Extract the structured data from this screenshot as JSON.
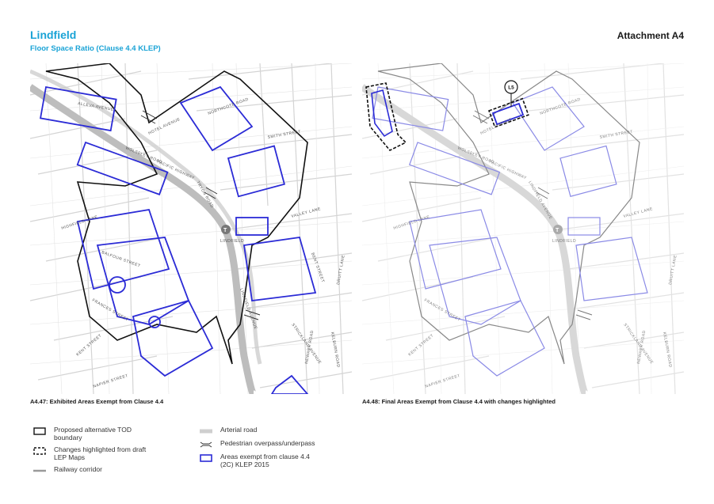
{
  "header": {
    "title": "Lindfield",
    "subtitle": "Floor Space Ratio (Clause 4.4 KLEP)",
    "attachment": "Attachment A4"
  },
  "maps": {
    "left": {
      "caption": "A4.47: Exhibited Areas Exempt from Clause 4.4",
      "streets": [
        "NORTHCOTE ROAD",
        "SMITH STREET",
        "VALLEY LANE",
        "PACIFIC HIGHWAY",
        "HIGHFIELD LANE",
        "WOLSELEY ROAD",
        "BALFOUR STREET",
        "FRANCES STREET",
        "LINDFIELD",
        "ALLEVA AVENUE",
        "NAPIER STREET",
        "KENT STREET",
        "STRICKLAND AVENUE",
        "NEWARK ROAD",
        "KELBURN ROAD",
        "TRYON ROAD",
        "LINDFIELD AVENUE",
        "BENT STREET",
        "HOTEL AVENUE",
        "DRUITT LANE"
      ]
    },
    "right": {
      "caption": "A4.48: Final Areas Exempt from Clause 4.4 with changes highlighted",
      "marker_label": "L5",
      "streets": [
        "NORTHCOTE ROAD",
        "SMITH STREET",
        "VALLEY LANE",
        "PACIFIC HIGHWAY",
        "HIGHFIELD LANE",
        "WOLSELEY ROAD",
        "FRANCES STREET",
        "LINDFIELD",
        "NAPIER STREET",
        "KENT STREET",
        "STRICKLAND AVENUE",
        "NEWARK ROAD",
        "KELBURN ROAD",
        "LINDFIELD AVENUE",
        "HOTEL AVENUE",
        "DRUITT LANE"
      ]
    }
  },
  "legend": {
    "items": [
      {
        "id": "tod",
        "label": "Proposed alternative TOD boundary",
        "icon": "black-outline-box"
      },
      {
        "id": "changes",
        "label": "Changes highlighted from draft LEP Maps",
        "icon": "dashed-outline-box"
      },
      {
        "id": "rail",
        "label": "Railway corridor",
        "icon": "grey-line"
      },
      {
        "id": "arterial",
        "label": "Arterial road",
        "icon": "grey-thick-line"
      },
      {
        "id": "overpass",
        "label": "Pedestrian overpass/underpass",
        "icon": "overpass-symbol"
      },
      {
        "id": "exempt",
        "label": "Areas exempt from clause 4.4 (2C) KLEP 2015",
        "icon": "blue-outline-box"
      }
    ]
  },
  "colors": {
    "title": "#1aa3d6",
    "exempt_blue": "#2b2bd6",
    "exempt_blue_light": "#8a8ae6",
    "tod_black": "#111111",
    "rail_grey": "#b5b5b5",
    "road_line": "#d0d0d0"
  }
}
